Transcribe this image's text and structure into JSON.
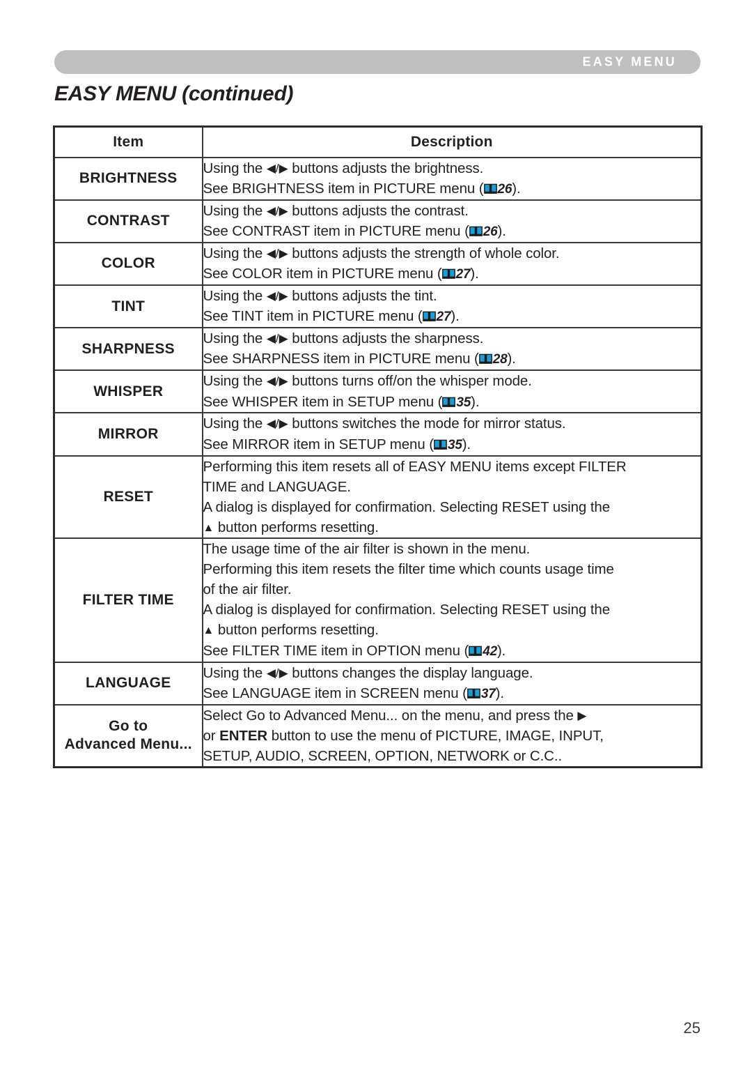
{
  "header": {
    "chapter_tab_label": "EASY MENU",
    "page_title": "EASY MENU (continued)"
  },
  "table": {
    "columns": [
      "Item",
      "Description"
    ],
    "rows": [
      {
        "item": "BRIGHTNESS",
        "lines": [
          {
            "pre": "Using the ",
            "arrows": true,
            "mid": " buttons adjusts the brightness."
          },
          {
            "pre": "See BRIGHTNESS item in PICTURE menu (",
            "book": true,
            "page": "26",
            "post": ")."
          }
        ]
      },
      {
        "item": "CONTRAST",
        "lines": [
          {
            "pre": "Using the ",
            "arrows": true,
            "mid": " buttons adjusts the contrast."
          },
          {
            "pre": "See CONTRAST item in PICTURE menu (",
            "book": true,
            "page": "26",
            "post": ")."
          }
        ]
      },
      {
        "item": "COLOR",
        "lines": [
          {
            "pre": "Using the ",
            "arrows": true,
            "mid": " buttons adjusts the strength of whole color."
          },
          {
            "pre": "See COLOR item in PICTURE menu (",
            "book": true,
            "page": "27",
            "post": ")."
          }
        ]
      },
      {
        "item": "TINT",
        "lines": [
          {
            "pre": "Using the ",
            "arrows": true,
            "mid": " buttons adjusts the tint."
          },
          {
            "pre": "See TINT item in PICTURE menu (",
            "book": true,
            "page": "27",
            "post": ")."
          }
        ]
      },
      {
        "item": "SHARPNESS",
        "lines": [
          {
            "pre": "Using the ",
            "arrows": true,
            "mid": " buttons adjusts the sharpness."
          },
          {
            "pre": "See SHARPNESS item in PICTURE menu (",
            "book": true,
            "page": "28",
            "post": ")."
          }
        ]
      },
      {
        "item": "WHISPER",
        "lines": [
          {
            "pre": "Using the ",
            "arrows": true,
            "mid": " buttons turns off/on the whisper mode."
          },
          {
            "pre": "See WHISPER item in SETUP menu (",
            "book": true,
            "page": "35",
            "post": ")."
          }
        ]
      },
      {
        "item": "MIRROR",
        "lines": [
          {
            "pre": "Using the ",
            "arrows": true,
            "mid": " buttons switches the mode for mirror status."
          },
          {
            "pre": "See MIRROR item in SETUP menu (",
            "book": true,
            "page": "35",
            "post": ")."
          }
        ]
      },
      {
        "item": "RESET",
        "lines": [
          {
            "pre": "Performing this item resets all of EASY MENU items except FILTER"
          },
          {
            "pre": "TIME and LANGUAGE."
          },
          {
            "pre": "A dialog is displayed for confirmation. Selecting RESET using the"
          },
          {
            "uparrow": true,
            "mid": " button performs resetting."
          }
        ]
      },
      {
        "item": "FILTER TIME",
        "lines": [
          {
            "pre": "The usage time of the air filter is shown in the menu."
          },
          {
            "pre": "Performing this item resets the filter time which counts usage time"
          },
          {
            "pre": "of the air filter."
          },
          {
            "pre": "A dialog is displayed for confirmation. Selecting RESET using the"
          },
          {
            "uparrow": true,
            "mid": " button performs resetting."
          },
          {
            "pre": "See FILTER TIME item in OPTION menu (",
            "book": true,
            "page": "42",
            "post": ")."
          }
        ]
      },
      {
        "item": "LANGUAGE",
        "lines": [
          {
            "pre": "Using the ",
            "arrows": true,
            "mid": " buttons changes the display language."
          },
          {
            "pre": "See LANGUAGE item in SCREEN menu (",
            "book": true,
            "page": "37",
            "post": ")."
          }
        ]
      },
      {
        "item": "Go to",
        "item_line2": "Advanced Menu...",
        "lines": [
          {
            "pre": "Select Go to Advanced Menu... on the menu, and press the ",
            "rightarrow": true
          },
          {
            "pre": "or ",
            "bold": "ENTER",
            "post": " button to use the menu of PICTURE, IMAGE, INPUT,"
          },
          {
            "pre": "SETUP, AUDIO, SCREEN, OPTION, NETWORK or C.C.."
          }
        ]
      }
    ]
  },
  "footer": {
    "page_number": "25"
  },
  "colors": {
    "header_bar": "#bfbfbf",
    "book_icon": "#1b9dd9",
    "text": "#231f20"
  }
}
